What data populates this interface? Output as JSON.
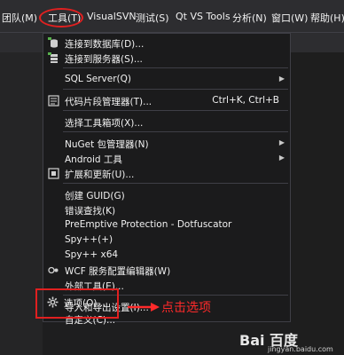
{
  "menubar": {
    "items": [
      "团队(M)",
      "工具(T)",
      "VisualSVN",
      "测试(S)",
      "Qt VS Tools",
      "分析(N)",
      "窗口(W)",
      "帮助(H)"
    ]
  },
  "menu": {
    "items": [
      {
        "label": "连接到数据库(D)..."
      },
      {
        "label": "连接到服务器(S)..."
      },
      {
        "label": "SQL Server(Q)"
      },
      {
        "label": "代码片段管理器(T)...",
        "shortcut": "Ctrl+K, Ctrl+B"
      },
      {
        "label": "选择工具箱项(X)..."
      },
      {
        "label": "NuGet 包管理器(N)"
      },
      {
        "label": "Android 工具"
      },
      {
        "label": "扩展和更新(U)..."
      },
      {
        "label": "创建 GUID(G)"
      },
      {
        "label": "错误查找(K)"
      },
      {
        "label": "PreEmptive Protection - Dotfuscator"
      },
      {
        "label": "Spy++(+)"
      },
      {
        "label": "Spy++ x64"
      },
      {
        "label": "WCF 服务配置编辑器(W)"
      },
      {
        "label": "外部工具(E)..."
      },
      {
        "label": "导入和导出设置(I)..."
      },
      {
        "label": "自定义(C)..."
      },
      {
        "label": "选项(O)..."
      }
    ]
  },
  "annotation": {
    "text": "点击选项"
  },
  "watermark": {
    "logo": "Bai 百度",
    "url": "jingyan.baidu.com"
  },
  "colors": {
    "menu_bg": "#1b1b1c",
    "menubar_bg": "#2d2d30",
    "annotation_red": "#e02020"
  }
}
